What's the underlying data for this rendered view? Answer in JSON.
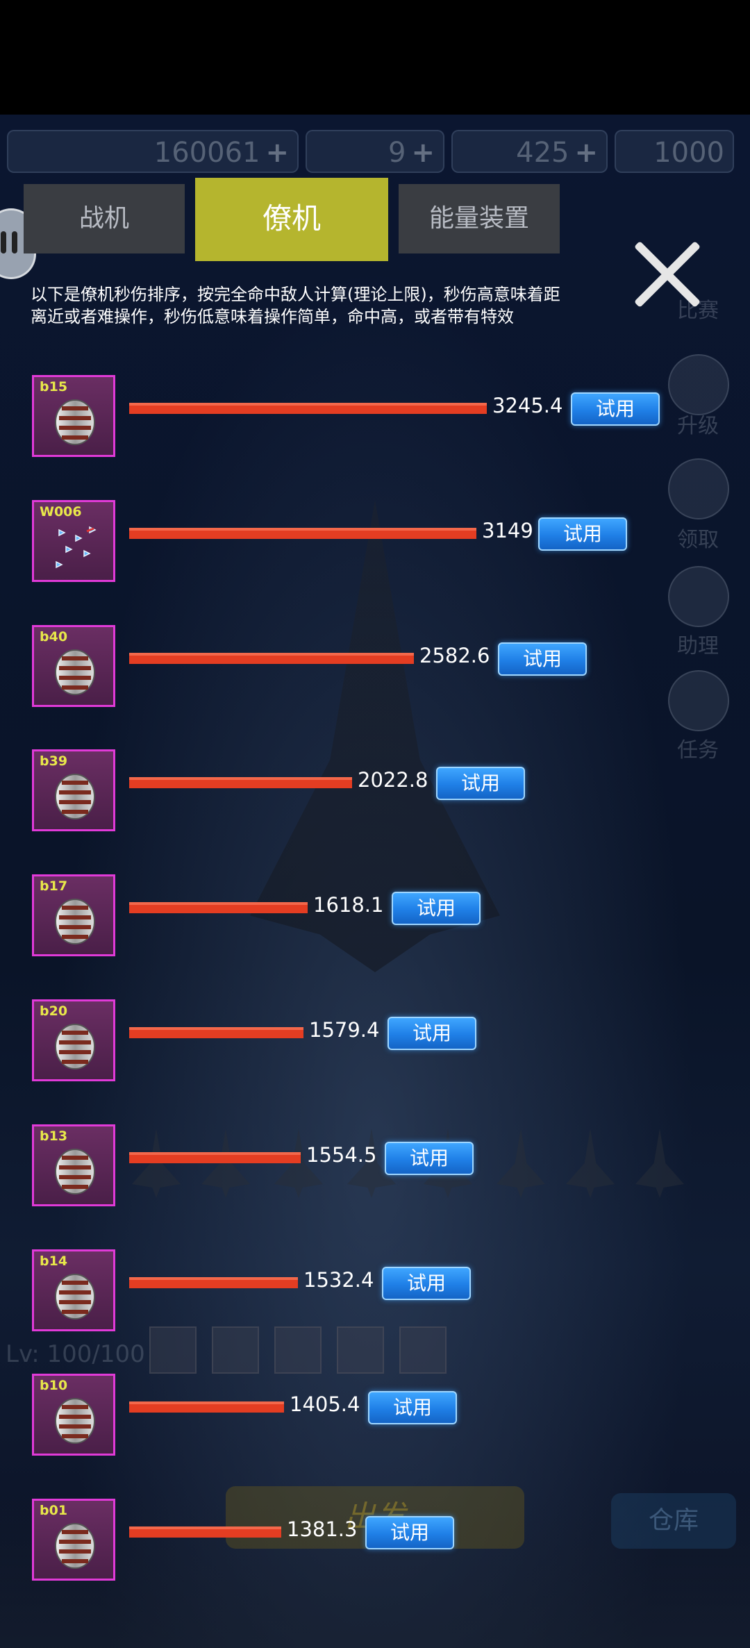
{
  "background": {
    "resources": [
      {
        "value": "160061",
        "icon": "coin-icon"
      },
      {
        "value": "9",
        "icon": "b-bomb-icon"
      },
      {
        "value": "425",
        "icon": "gem-icon"
      },
      {
        "value": "1000",
        "icon": "ticket-icon"
      }
    ],
    "side_menu": [
      "比赛",
      "升级",
      "领取",
      "助理",
      "任务"
    ],
    "level_text": "Lv: 100/100",
    "go_label": "出发",
    "depot_label": "仓库"
  },
  "tabs": [
    {
      "label": "战机",
      "active": false
    },
    {
      "label": "僚机",
      "active": true
    },
    {
      "label": "能量装置",
      "active": false
    }
  ],
  "description": "以下是僚机秒伤排序，按完全命中敌人计算(理论上限)，秒伤高意味着距离近或者难操作，秒伤低意味着操作简单，命中高，或者带有特效",
  "try_label": "试用",
  "bar_max": 3245.4,
  "rows": [
    {
      "code": "b15",
      "dps": "3245.4",
      "value": 3245.4
    },
    {
      "code": "W006",
      "dps": "3149",
      "value": 3149
    },
    {
      "code": "b40",
      "dps": "2582.6",
      "value": 2582.6
    },
    {
      "code": "b39",
      "dps": "2022.8",
      "value": 2022.8
    },
    {
      "code": "b17",
      "dps": "1618.1",
      "value": 1618.1
    },
    {
      "code": "b20",
      "dps": "1579.4",
      "value": 1579.4
    },
    {
      "code": "b13",
      "dps": "1554.5",
      "value": 1554.5
    },
    {
      "code": "b14",
      "dps": "1532.4",
      "value": 1532.4
    },
    {
      "code": "b10",
      "dps": "1405.4",
      "value": 1405.4
    },
    {
      "code": "b01",
      "dps": "1381.3",
      "value": 1381.3
    }
  ],
  "colors": {
    "bar": "#e43d22",
    "active_tab": "#b5b52e",
    "try_button": "#1f7fe6",
    "thumb_border": "#e13ad8"
  }
}
